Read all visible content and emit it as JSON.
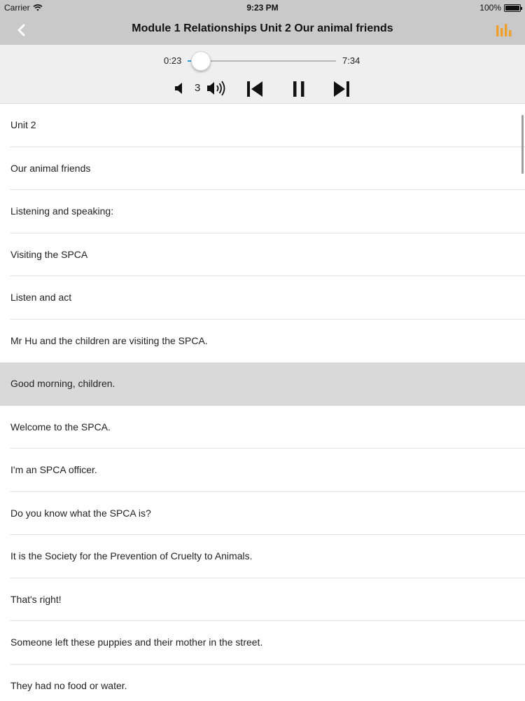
{
  "status_bar": {
    "carrier": "Carrier",
    "time": "9:23 PM",
    "battery": "100%"
  },
  "nav": {
    "title": "Module 1 Relationships Unit 2 Our animal friends",
    "back_icon": "chevron-left-icon",
    "right_icon": "bar-chart-icon",
    "accent_color": "#f0a028"
  },
  "player": {
    "current_time": "0:23",
    "duration": "7:34",
    "progress_fraction": 0.05,
    "volume": "3",
    "progress_color": "#2b9fd8"
  },
  "list": {
    "selected_index": 6,
    "items": [
      "Unit 2",
      "Our animal friends",
      "Listening and speaking:",
      "Visiting the SPCA",
      "Listen and act",
      "Mr Hu and the children are visiting the SPCA.",
      "Good morning, children.",
      "Welcome to the SPCA.",
      "I'm an SPCA officer.",
      "Do you know what the SPCA is?",
      "It is the Society for the Prevention of Cruelty to Animals.",
      "That's right!",
      "Someone left these puppies and their mother in the street.",
      "They had no food or water."
    ]
  }
}
